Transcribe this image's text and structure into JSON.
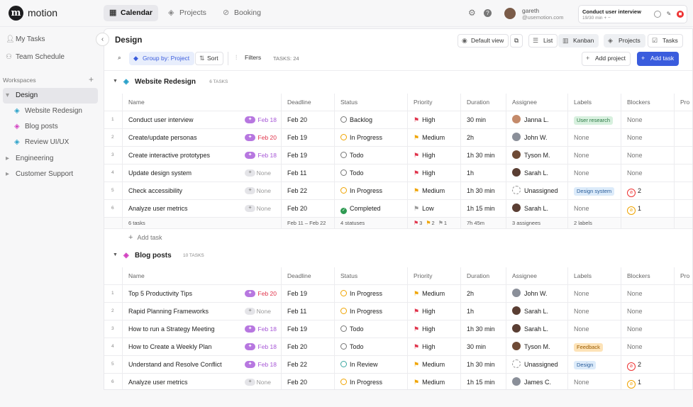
{
  "app": {
    "brand": "motion",
    "logo": "m-logo"
  },
  "nav": [
    {
      "label": "Calendar",
      "icon": "calendar-icon",
      "glyph": "▦",
      "active": true
    },
    {
      "label": "Projects",
      "icon": "projects-icon",
      "glyph": "◈",
      "active": false
    },
    {
      "label": "Booking",
      "icon": "link-icon",
      "glyph": "⊘",
      "active": false
    }
  ],
  "user": {
    "name": "gareth",
    "email": "@usemotion.com"
  },
  "current_task": {
    "title": "Conduct user interview",
    "time": "19/30 min",
    "controls": "+ −"
  },
  "sidebar": {
    "my_tasks": "My Tasks",
    "team_schedule": "Team Schedule",
    "workspaces_label": "Workspaces",
    "add": "+",
    "items": [
      {
        "label": "Design",
        "glyph": "▾",
        "selected": true
      },
      {
        "label": "Website Redesign",
        "glyph": "◈",
        "color": "#27a0c8",
        "sub": true
      },
      {
        "label": "Blog posts",
        "glyph": "◈",
        "color": "#d23fc0",
        "sub": true
      },
      {
        "label": "Review UI/UX",
        "glyph": "◈",
        "color": "#27a0c8",
        "sub": true
      },
      {
        "label": "Engineering",
        "glyph": "▸"
      },
      {
        "label": "Customer Support",
        "glyph": "▸"
      }
    ]
  },
  "main": {
    "title": "Design",
    "toolbar": {
      "default_view": "Default view",
      "list": "List",
      "kanban": "Kanban",
      "projects": "Projects",
      "tasks": "Tasks",
      "group_by": "Group by: Project",
      "sort": "Sort",
      "filters": "Filters",
      "tasks_count": "TASKS: 24",
      "add_project": "Add project",
      "add_task": "Add task"
    },
    "columns": [
      "Name",
      "Deadline",
      "Status",
      "Priority",
      "Duration",
      "Assignee",
      "Labels",
      "Blockers",
      "Pro"
    ],
    "add_task_label": "Add task",
    "groups": [
      {
        "name": "Website Redesign",
        "count": "6 TASKS",
        "color": "#27a0c8",
        "rows": [
          {
            "num": "1",
            "name": "Conduct user interview",
            "date": "Feb 18",
            "date_color": "#a655d6",
            "sched": true,
            "deadline": "Feb 20",
            "status": "Backlog",
            "st": "backlog",
            "priority": "High",
            "pcolor": "#e0324a",
            "duration": "30 min",
            "assignee": "Janna L.",
            "avc": "#c48a6a",
            "label": "User research",
            "lbg": "#d7f0de",
            "lfg": "#2c7a45",
            "blockers": "None"
          },
          {
            "num": "2",
            "name": "Create/update personas",
            "date": "Feb 20",
            "date_color": "#e0324a",
            "sched": true,
            "deadline": "Feb 19",
            "status": "In Progress",
            "st": "progress",
            "priority": "Medium",
            "pcolor": "#f0a400",
            "duration": "2h",
            "assignee": "John W.",
            "avc": "#8a8f99",
            "label": "None",
            "blockers": "None"
          },
          {
            "num": "3",
            "name": "Create interactive prototypes",
            "date": "Feb 18",
            "date_color": "#a655d6",
            "sched": true,
            "deadline": "Feb 19",
            "status": "Todo",
            "st": "todo",
            "priority": "High",
            "pcolor": "#e0324a",
            "duration": "1h 30 min",
            "assignee": "Tyson M.",
            "avc": "#6e4a35",
            "label": "None",
            "blockers": "None"
          },
          {
            "num": "4",
            "name": "Update design system",
            "date": "None",
            "date_color": "#999",
            "sched": false,
            "deadline": "Feb 11",
            "status": "Todo",
            "st": "todo",
            "priority": "High",
            "pcolor": "#e0324a",
            "duration": "1h",
            "assignee": "Sarah L.",
            "avc": "#5a3e33",
            "label": "None",
            "blockers": "None"
          },
          {
            "num": "5",
            "name": "Check accessibility",
            "date": "None",
            "date_color": "#999",
            "sched": false,
            "deadline": "Feb 22",
            "status": "In Progress",
            "st": "progress",
            "priority": "Medium",
            "pcolor": "#f0a400",
            "duration": "1h 30 min",
            "assignee": "Unassigned",
            "avc": "",
            "label": "Design system",
            "lbg": "#dcebfa",
            "lfg": "#2a5d9a",
            "blockers": "2",
            "btype": "r"
          },
          {
            "num": "6",
            "name": "Analyze user metrics",
            "date": "None",
            "date_color": "#999",
            "sched": false,
            "deadline": "Feb 20",
            "status": "Completed",
            "st": "done",
            "priority": "Low",
            "pcolor": "#999",
            "duration": "1h 15 min",
            "assignee": "Sarah L.",
            "avc": "#5a3e33",
            "label": "None",
            "blockers": "1",
            "btype": "y"
          }
        ],
        "summary": {
          "name": "6 tasks",
          "deadline": "Feb 11 – Feb 22",
          "status": "4 statuses",
          "p_high": "3",
          "p_med": "2",
          "p_low": "1",
          "duration": "7h 45m",
          "assignee": "3 assignees",
          "labels": "2 labels"
        }
      },
      {
        "name": "Blog posts",
        "count": "10 TASKS",
        "color": "#d23fc0",
        "rows": [
          {
            "num": "1",
            "name": "Top 5 Productivity Tips",
            "date": "Feb 20",
            "date_color": "#e0324a",
            "sched": true,
            "deadline": "Feb 19",
            "status": "In Progress",
            "st": "progress",
            "priority": "Medium",
            "pcolor": "#f0a400",
            "duration": "2h",
            "assignee": "John W.",
            "avc": "#8a8f99",
            "label": "None",
            "blockers": "None"
          },
          {
            "num": "2",
            "name": "Rapid Planning Frameworks",
            "date": "None",
            "date_color": "#999",
            "sched": false,
            "deadline": "Feb 11",
            "status": "In Progress",
            "st": "progress",
            "priority": "High",
            "pcolor": "#e0324a",
            "duration": "1h",
            "assignee": "Sarah L.",
            "avc": "#5a3e33",
            "label": "None",
            "blockers": "None"
          },
          {
            "num": "3",
            "name": "How to run a Strategy Meeting",
            "date": "Feb 18",
            "date_color": "#a655d6",
            "sched": true,
            "deadline": "Feb 19",
            "status": "Todo",
            "st": "todo",
            "priority": "High",
            "pcolor": "#e0324a",
            "duration": "1h 30 min",
            "assignee": "Sarah L.",
            "avc": "#5a3e33",
            "label": "None",
            "blockers": "None"
          },
          {
            "num": "4",
            "name": "How to Create a Weekly Plan",
            "date": "Feb 18",
            "date_color": "#a655d6",
            "sched": true,
            "deadline": "Feb 20",
            "status": "Todo",
            "st": "todo",
            "priority": "High",
            "pcolor": "#e0324a",
            "duration": "30 min",
            "assignee": "Tyson M.",
            "avc": "#6e4a35",
            "label": "Feedback",
            "lbg": "#fde3b8",
            "lfg": "#9a5b00",
            "blockers": "None"
          },
          {
            "num": "5",
            "name": "Understand and Resolve Conflict",
            "date": "Feb 18",
            "date_color": "#a655d6",
            "sched": true,
            "deadline": "Feb 22",
            "status": "In Review",
            "st": "review",
            "priority": "Medium",
            "pcolor": "#f0a400",
            "duration": "1h 30 min",
            "assignee": "Unassigned",
            "avc": "",
            "label": "Design",
            "lbg": "#dcebfa",
            "lfg": "#2a5d9a",
            "blockers": "2",
            "btype": "r"
          },
          {
            "num": "6",
            "name": "Analyze user metrics",
            "date": "None",
            "date_color": "#999",
            "sched": false,
            "deadline": "Feb 20",
            "status": "In Progress",
            "st": "progress",
            "priority": "Medium",
            "pcolor": "#f0a400",
            "duration": "1h 15 min",
            "assignee": "James C.",
            "avc": "#8a8f99",
            "label": "None",
            "blockers": "1",
            "btype": "y"
          }
        ]
      }
    ]
  }
}
